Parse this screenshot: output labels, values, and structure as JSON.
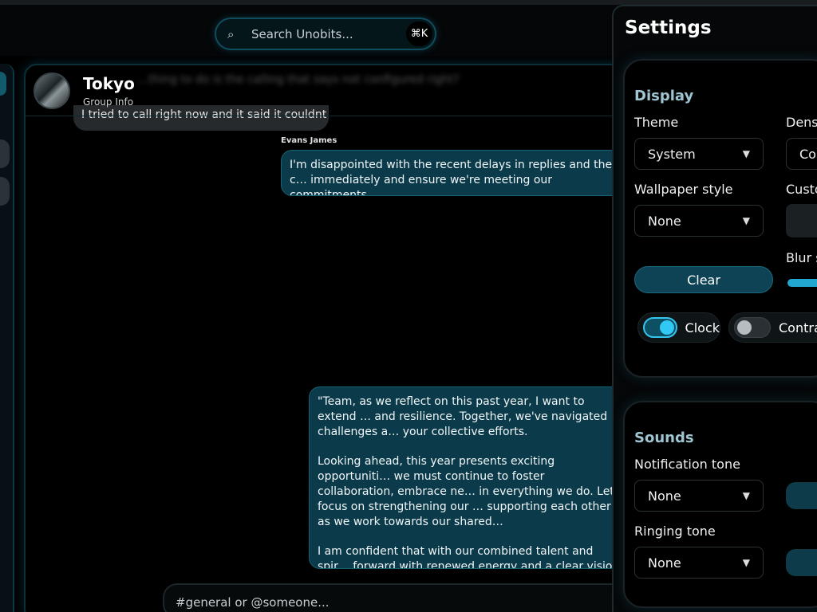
{
  "search": {
    "placeholder": "Search Unobits...",
    "shortcut": "⌘K"
  },
  "chat": {
    "title": "Tokyo",
    "subtitle": "Group Info",
    "ghost_text": "…thing to do is the calling that says not configured right?",
    "old_message": "I tried to call right now and it said it couldnt",
    "sender_name": "Evans James",
    "message1": "I'm disappointed with the recent delays in replies and the c… immediately and ensure we're meeting our commitments.",
    "message2": {
      "p1": "\"Team, as we reflect on this past year, I want to extend … and resilience. Together, we've navigated challenges a… your collective efforts.",
      "p2": "Looking ahead, this year presents exciting opportuniti… we must continue to foster collaboration, embrace ne… in everything we do. Let's focus on strengthening our … supporting each other as we work towards our shared…",
      "p3": "I am confident that with our combined talent and spir… forward with renewed energy and a clear vision for su…"
    },
    "composer_placeholder": "#general or @someone..."
  },
  "settings": {
    "title": "Settings",
    "display": {
      "title": "Display",
      "theme_label": "Theme",
      "theme_value": "System",
      "density_label": "Densi",
      "density_value": "Co",
      "wallpaper_label": "Wallpaper style",
      "wallpaper_value": "None",
      "custom_label": "Custo",
      "clear_label": "Clear",
      "blur_label": "Blur s",
      "clock_label": "Clock",
      "clock_on": true,
      "contrast_label": "Contras",
      "contrast_on": false
    },
    "sounds": {
      "title": "Sounds",
      "notification_label": "Notification tone",
      "notification_value": "None",
      "ringing_label": "Ringing tone",
      "ringing_value": "None"
    }
  },
  "icons": {
    "search": "search-icon",
    "caret": "chevron-down-icon"
  },
  "colors": {
    "accent": "#21a7d0",
    "bubble": "#0b3a4a",
    "section_title": "#9fc4d2"
  }
}
